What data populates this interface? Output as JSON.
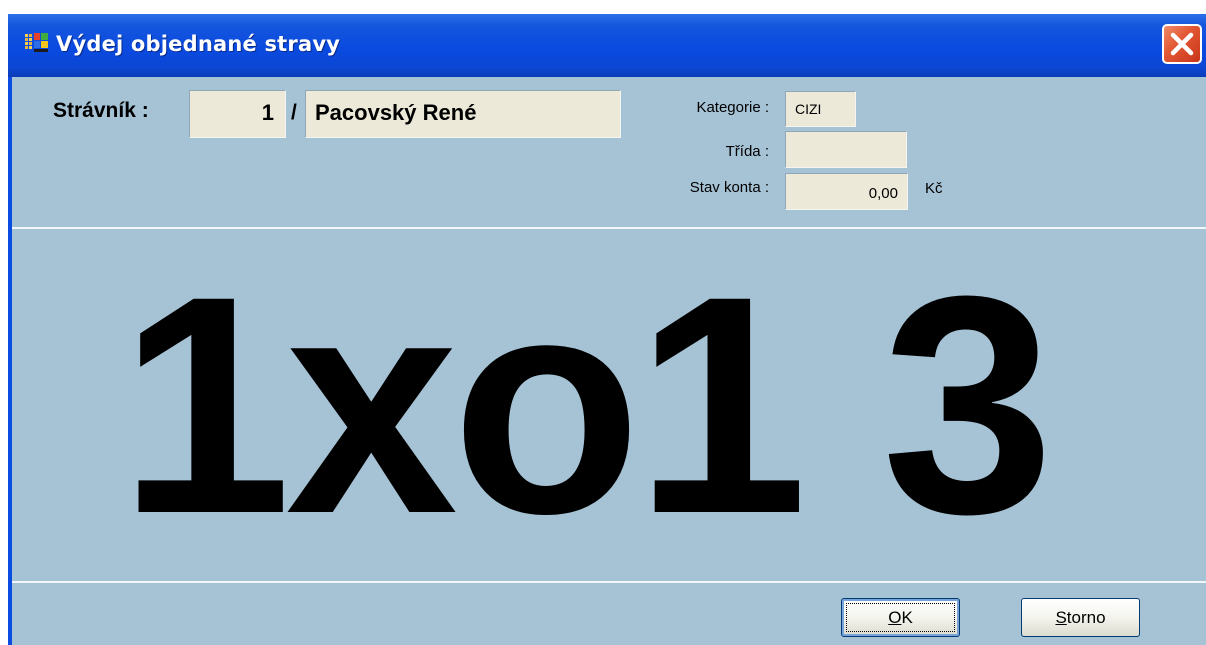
{
  "window": {
    "title": "Výdej objednané stravy",
    "icon": "application-grid-icon",
    "close_icon": "close-x-icon"
  },
  "diner": {
    "label": "Strávník :",
    "id": "1",
    "separator": "/",
    "name": "Pacovský René"
  },
  "details": {
    "category_label": "Kategorie :",
    "category_value": "CIZI",
    "class_label": "Třída :",
    "class_value": "",
    "balance_label": "Stav konta :",
    "balance_value": "0,00",
    "currency": "Kč"
  },
  "order": {
    "display": "1xo1 3"
  },
  "buttons": {
    "ok_label": "OK",
    "ok_hotkey": "O",
    "storno_label": "Storno",
    "storno_hotkey": "S"
  },
  "colors": {
    "titlebar": "#0a4be0",
    "client_background": "#a6c3d6",
    "field_background": "#ece9d8",
    "close_button": "#e35a35"
  }
}
